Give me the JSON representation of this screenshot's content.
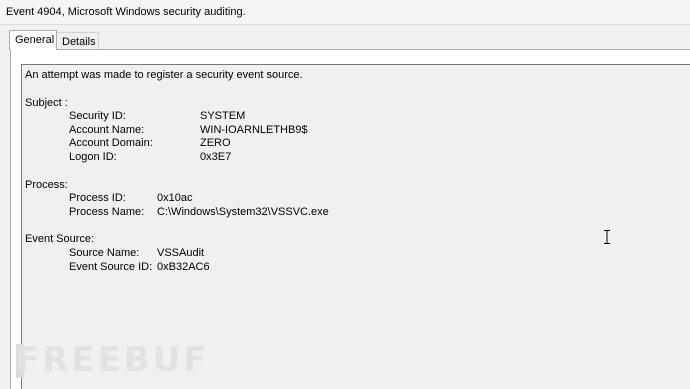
{
  "window": {
    "title": "Event 4904, Microsoft Windows security auditing."
  },
  "tabs": [
    {
      "label": "General",
      "selected": true
    },
    {
      "label": "Details",
      "selected": false
    }
  ],
  "event": {
    "summary": "An attempt was made to register a security event source.",
    "subject": {
      "heading": "Subject :",
      "fields": [
        {
          "label": "Security ID:",
          "value": "SYSTEM"
        },
        {
          "label": "Account Name:",
          "value": "WIN-IOARNLETHB9$"
        },
        {
          "label": "Account Domain:",
          "value": "ZERO"
        },
        {
          "label": "Logon ID:",
          "value": "0x3E7"
        }
      ]
    },
    "process": {
      "heading": "Process:",
      "fields": [
        {
          "label": "Process ID:",
          "value": "0x10ac"
        },
        {
          "label": "Process Name:",
          "value": "C:\\Windows\\System32\\VSSVC.exe"
        }
      ]
    },
    "event_source": {
      "heading": "Event Source:",
      "fields": [
        {
          "label": "Source Name:",
          "value": "VSSAudit"
        },
        {
          "label": "Event Source ID:",
          "value": "0xB32AC6"
        }
      ]
    }
  },
  "watermark": {
    "text": "FREEBUF"
  },
  "icons": {
    "cursor": "ibeam-cursor-icon"
  }
}
